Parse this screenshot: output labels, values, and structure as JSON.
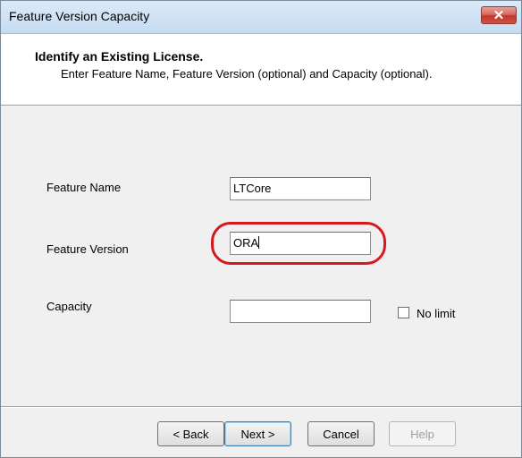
{
  "window": {
    "title": "Feature Version Capacity",
    "close_label": "✕"
  },
  "header": {
    "title": "Identify an Existing License.",
    "subtitle": "Enter Feature Name, Feature Version (optional) and Capacity (optional)."
  },
  "form": {
    "feature_name_label": "Feature Name",
    "feature_name_value": "LTCore",
    "feature_version_label": "Feature Version",
    "feature_version_value": "ORA",
    "capacity_label": "Capacity",
    "capacity_value": "",
    "no_limit_label": "No limit",
    "no_limit_checked": false
  },
  "buttons": {
    "back": "< Back",
    "next": "Next >",
    "cancel": "Cancel",
    "help": "Help"
  },
  "colors": {
    "highlight": "#d7191e",
    "close_button": "#c2372b"
  }
}
